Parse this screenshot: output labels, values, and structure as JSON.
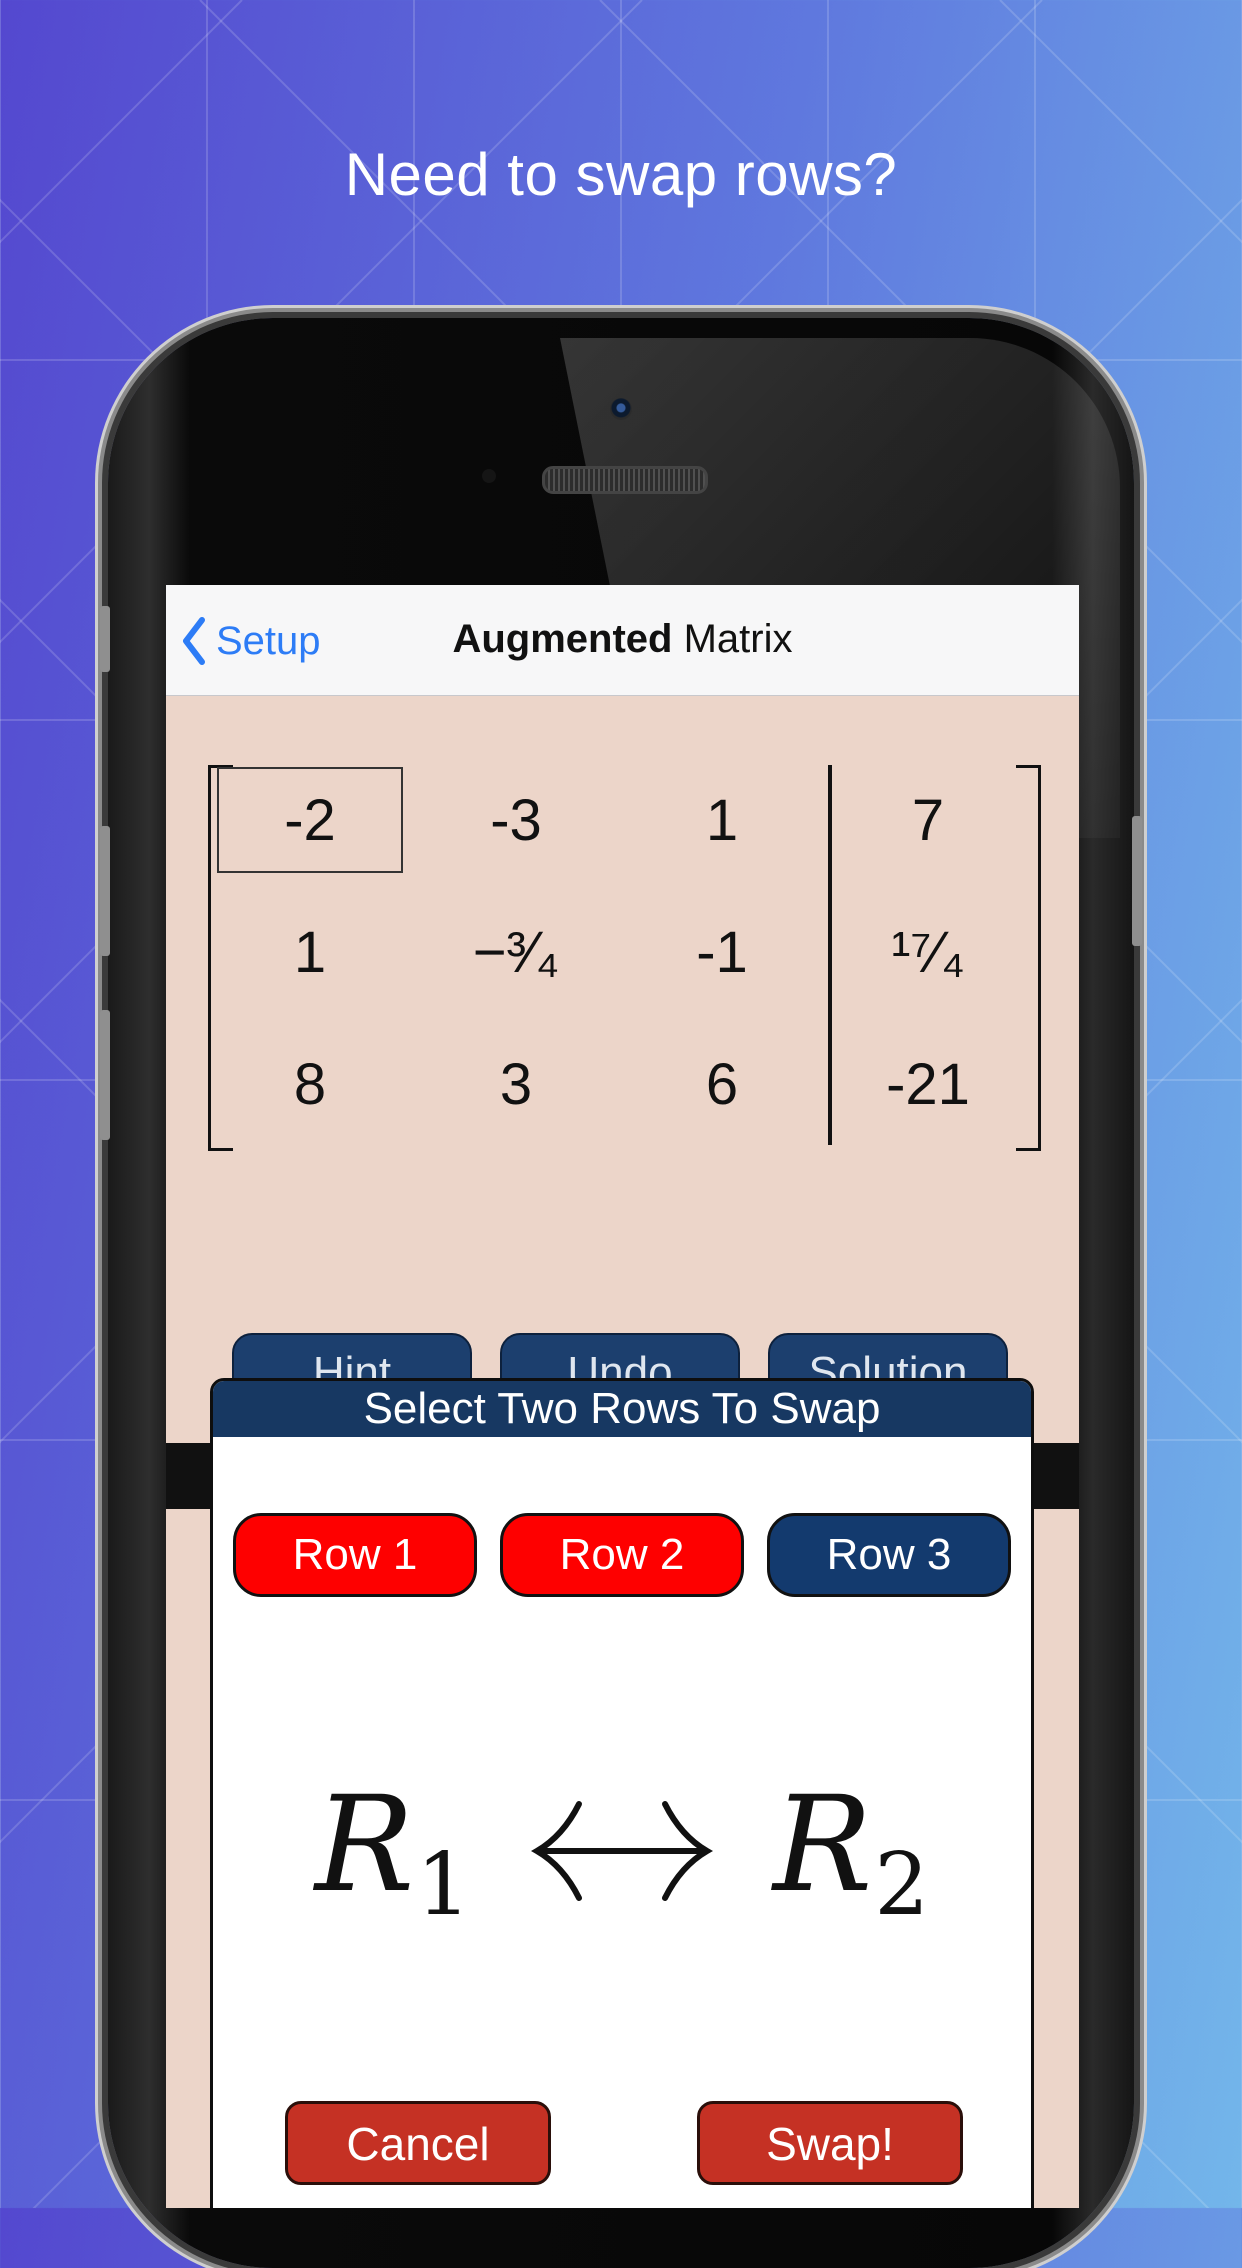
{
  "headline": "Need to swap rows?",
  "nav": {
    "back_label": "Setup",
    "title_bold": "Augmented",
    "title_rest": "Matrix"
  },
  "matrix": {
    "rows": [
      [
        "-2",
        "-3",
        "1",
        "7"
      ],
      [
        "1",
        "−³⁄₄",
        "-1",
        "¹⁷⁄₄"
      ],
      [
        "8",
        "3",
        "6",
        "-21"
      ]
    ],
    "selected_cell": "-2"
  },
  "actions": {
    "hint": "Hint",
    "undo": "Undo",
    "solution": "Solution"
  },
  "dialog": {
    "title": "Select Two Rows To Swap",
    "row_buttons": [
      {
        "label": "Row 1",
        "selected": true
      },
      {
        "label": "Row 2",
        "selected": true
      },
      {
        "label": "Row 3",
        "selected": false
      }
    ],
    "expression": {
      "left_var": "R",
      "left_sub": "1",
      "right_var": "R",
      "right_sub": "2"
    },
    "cancel": "Cancel",
    "swap": "Swap!"
  },
  "colors": {
    "selected_row": "#fe0000",
    "unselected_row": "#133a6e",
    "footer_button": "#c53124",
    "link": "#2d7cf6"
  }
}
